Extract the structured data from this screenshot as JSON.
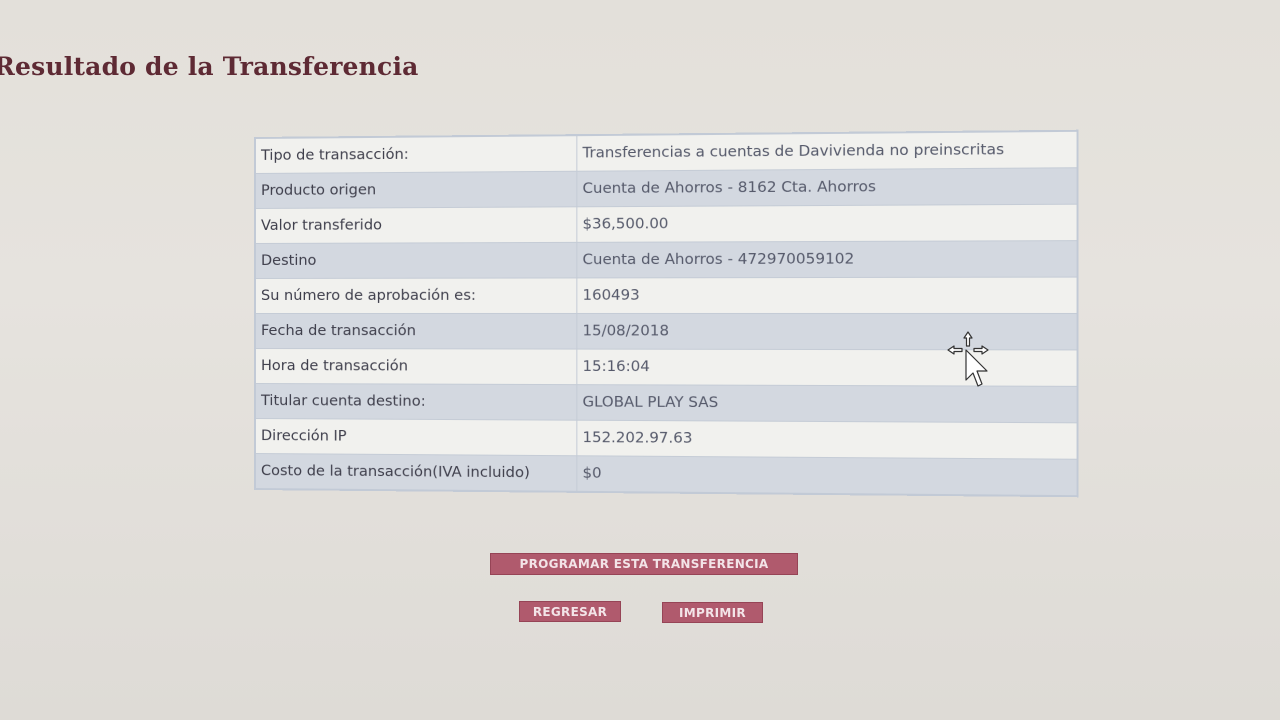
{
  "page": {
    "title": "Resultado de la Transferencia"
  },
  "details": [
    {
      "label": "Tipo de transacción:",
      "value": "Transferencias a cuentas de Davivienda no preinscritas"
    },
    {
      "label": "Producto origen",
      "value": "Cuenta de Ahorros - 8162 Cta. Ahorros"
    },
    {
      "label": "Valor transferido",
      "value": "$36,500.00"
    },
    {
      "label": "Destino",
      "value": "Cuenta de Ahorros - 472970059102"
    },
    {
      "label": "Su número de aprobación es:",
      "value": "160493"
    },
    {
      "label": "Fecha de transacción",
      "value": "15/08/2018"
    },
    {
      "label": "Hora de transacción",
      "value": "15:16:04"
    },
    {
      "label": "Titular cuenta destino:",
      "value": "GLOBAL PLAY SAS"
    },
    {
      "label": "Dirección IP",
      "value": "152.202.97.63"
    },
    {
      "label": "Costo de la transacción(IVA incluido)",
      "value": "$0"
    }
  ],
  "actions": {
    "programar": "PROGRAMAR ESTA TRANSFERENCIA",
    "regresar": "REGRESAR",
    "imprimir": "IMPRIMIR"
  },
  "colors": {
    "accent": "#b05a6d",
    "title": "#5e2a34",
    "row_alt": "#d3d8e0"
  },
  "icons": {
    "cursor": "move-cursor-icon"
  }
}
